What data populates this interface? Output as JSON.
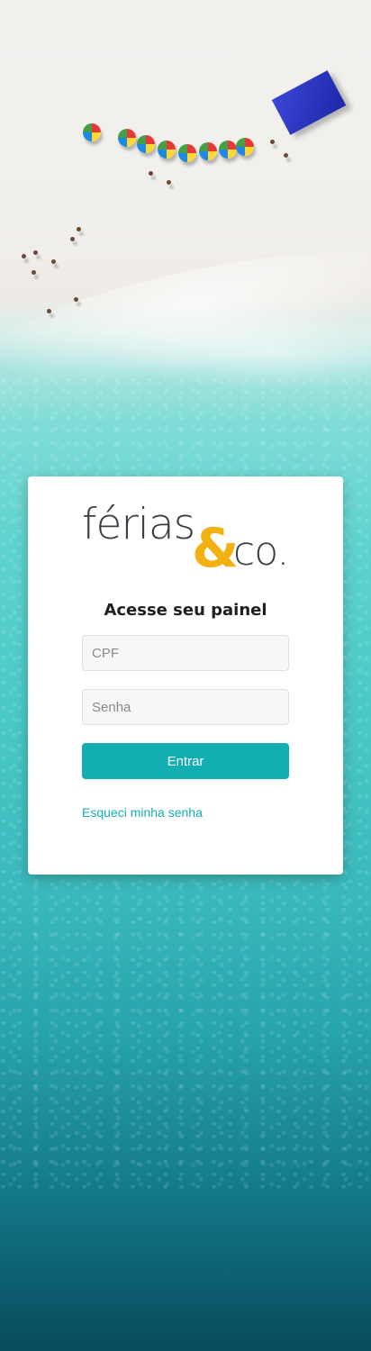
{
  "brand": {
    "name_part1": "férias",
    "ampersand": "&",
    "name_part2": "co.",
    "primary_color": "#3b3d45",
    "accent_color": "#f3b011"
  },
  "login": {
    "heading": "Acesse seu painel",
    "cpf_placeholder": "CPF",
    "cpf_value": "",
    "password_placeholder": "Senha",
    "password_value": "",
    "submit_label": "Entrar",
    "forgot_label": "Esqueci minha senha",
    "button_color": "#13aeb1"
  },
  "background": {
    "scene": "beach-aerial-photo"
  }
}
